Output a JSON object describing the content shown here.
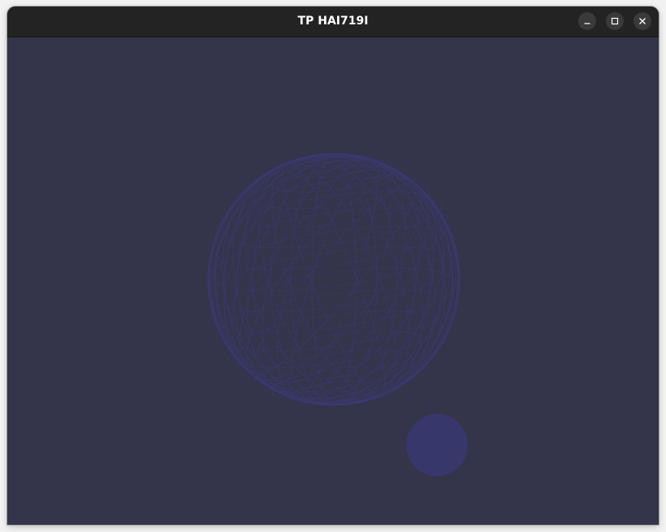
{
  "window": {
    "title": "TP HAI719I"
  },
  "controls": {
    "minimize_icon": "minimize-icon",
    "maximize_icon": "maximize-icon",
    "close_icon": "close-icon"
  },
  "scene": {
    "background_color": "#34344a",
    "wire_color": "#3d3b74",
    "small_sphere_color": "#3a3872"
  }
}
